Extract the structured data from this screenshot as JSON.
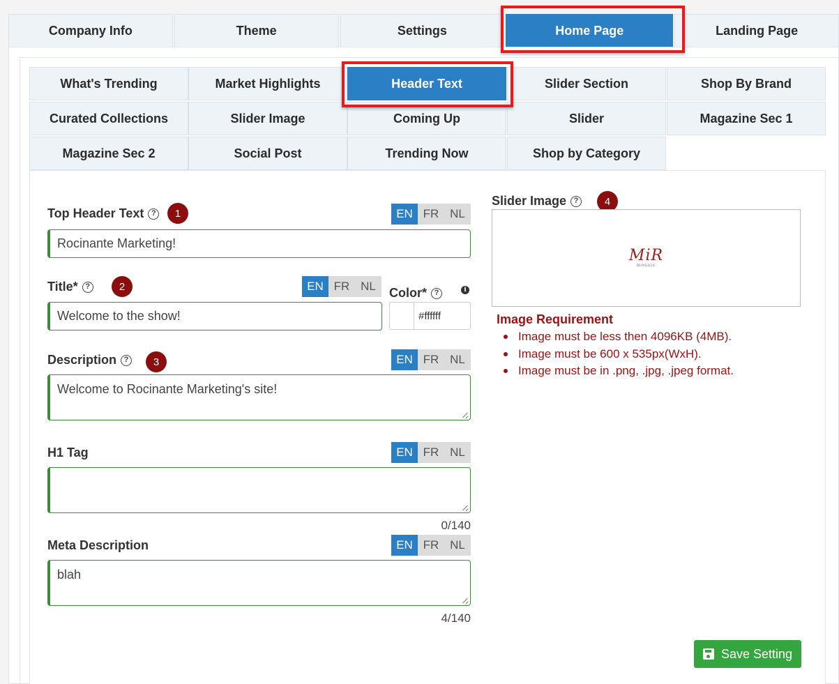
{
  "outer_tabs": [
    "Company Info",
    "Theme",
    "Settings",
    "Home Page",
    "Landing Page"
  ],
  "inner_tabs": {
    "row1": [
      "What's Trending",
      "Market Highlights",
      "Header Text",
      "Slider Section",
      "Shop By Brand"
    ],
    "row2": [
      "Curated Collections",
      "Slider Image",
      "Coming Up",
      "Slider",
      "Magazine Sec 1"
    ],
    "row3": [
      "Magazine Sec 2",
      "Social Post",
      "Trending Now",
      "Shop by Category"
    ]
  },
  "langs": [
    "EN",
    "FR",
    "NL"
  ],
  "form": {
    "top_header": {
      "label": "Top Header Text",
      "badge": "1",
      "value": "Rocinante Marketing!"
    },
    "title": {
      "label": "Title*",
      "badge": "2",
      "value": "Welcome to the show!"
    },
    "color": {
      "label": "Color*",
      "value": "#ffffff"
    },
    "description": {
      "label": "Description",
      "badge": "3",
      "value": "Welcome to Rocinante Marketing's site!"
    },
    "h1": {
      "label": "H1 Tag",
      "value": "",
      "counter": "0/140"
    },
    "meta": {
      "label": "Meta Description",
      "value": "blah",
      "counter": "4/140"
    }
  },
  "slider_image": {
    "label": "Slider Image",
    "badge": "4",
    "logo_text": "MiR",
    "logo_sub": "mosaic"
  },
  "requirements": {
    "title": "Image Requirement",
    "items": [
      "Image must be less then 4096KB (4MB).",
      "Image must be 600 x 535px(WxH).",
      "Image must be in .png, .jpg, .jpeg format."
    ]
  },
  "save_label": "Save Setting",
  "colors": {
    "accent": "#2b7fc4",
    "highlight": "#e41c1c",
    "badge": "#8b0d0d",
    "success": "#35a540",
    "error": "#9a1212"
  }
}
